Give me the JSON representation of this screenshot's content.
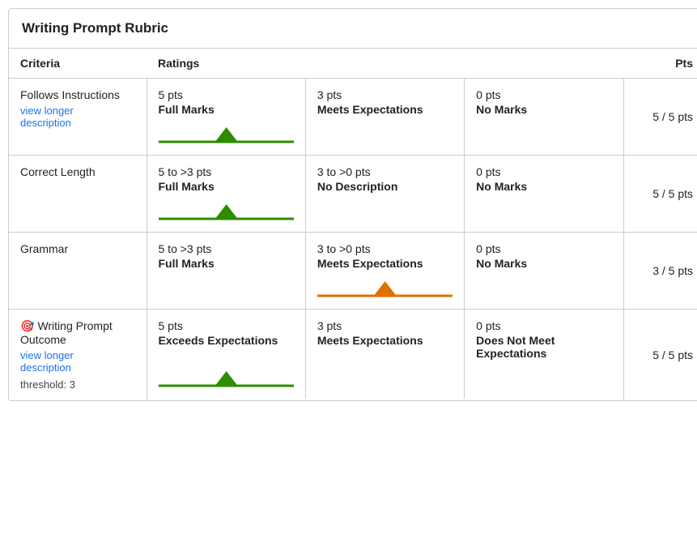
{
  "rubric": {
    "title": "Writing Prompt Rubric",
    "headers": {
      "criteria": "Criteria",
      "ratings": "Ratings",
      "pts": "Pts"
    },
    "rows": [
      {
        "id": "follows-instructions",
        "criteria": "Follows Instructions",
        "hasViewLonger": true,
        "hasOutcomeIcon": false,
        "threshold": null,
        "pts": "5 / 5 pts",
        "ratings": [
          {
            "pts": "5 pts",
            "label": "Full Marks",
            "indicator": "green",
            "active": true
          },
          {
            "pts": "3 pts",
            "label": "Meets Expectations",
            "indicator": null,
            "active": false
          },
          {
            "pts": "0 pts",
            "label": "No Marks",
            "indicator": null,
            "active": false
          }
        ]
      },
      {
        "id": "correct-length",
        "criteria": "Correct Length",
        "hasViewLonger": false,
        "hasOutcomeIcon": false,
        "threshold": null,
        "pts": "5 / 5 pts",
        "ratings": [
          {
            "pts": "5 to >3 pts",
            "label": "Full Marks",
            "indicator": "green",
            "active": true
          },
          {
            "pts": "3 to >0 pts",
            "label": "No Description",
            "indicator": null,
            "active": false
          },
          {
            "pts": "0 pts",
            "label": "No Marks",
            "indicator": null,
            "active": false
          }
        ]
      },
      {
        "id": "grammar",
        "criteria": "Grammar",
        "hasViewLonger": false,
        "hasOutcomeIcon": false,
        "threshold": null,
        "pts": "3 / 5 pts",
        "ratings": [
          {
            "pts": "5 to >3 pts",
            "label": "Full Marks",
            "indicator": null,
            "active": false
          },
          {
            "pts": "3 to >0 pts",
            "label": "Meets Expectations",
            "indicator": "orange",
            "active": true
          },
          {
            "pts": "0 pts",
            "label": "No Marks",
            "indicator": null,
            "active": false
          }
        ]
      },
      {
        "id": "writing-prompt-outcome",
        "criteria": "Writing Prompt Outcome",
        "hasViewLonger": true,
        "hasOutcomeIcon": true,
        "threshold": "threshold: 3",
        "pts": "5 / 5 pts",
        "ratings": [
          {
            "pts": "5 pts",
            "label": "Exceeds Expectations",
            "indicator": "green",
            "active": true
          },
          {
            "pts": "3 pts",
            "label": "Meets Expectations",
            "indicator": null,
            "active": false
          },
          {
            "pts": "0 pts",
            "label": "Does Not Meet Expectations",
            "indicator": null,
            "active": false
          }
        ]
      }
    ]
  }
}
